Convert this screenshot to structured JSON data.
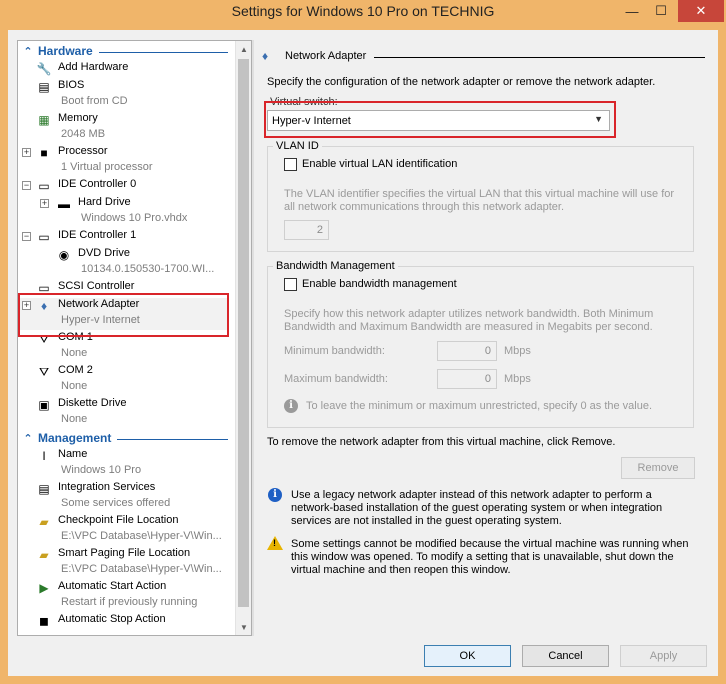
{
  "window": {
    "title": "Settings for Windows 10 Pro on TECHNIG",
    "minimize": "—",
    "maximize": "☐",
    "close": "✕"
  },
  "tree": {
    "hardware_label": "Hardware",
    "management_label": "Management",
    "hardware": [
      {
        "label": "Add Hardware",
        "sub": "",
        "icon": "add-hardware-icon"
      },
      {
        "label": "BIOS",
        "sub": "Boot from CD",
        "icon": "bios-icon"
      },
      {
        "label": "Memory",
        "sub": "2048 MB",
        "icon": "memory-icon"
      },
      {
        "label": "Processor",
        "sub": "1 Virtual processor",
        "icon": "processor-icon"
      },
      {
        "label": "IDE Controller 0",
        "sub": "",
        "icon": "ide-controller-icon"
      },
      {
        "label": "Hard Drive",
        "sub": "Windows 10 Pro.vhdx",
        "icon": "hard-drive-icon"
      },
      {
        "label": "IDE Controller 1",
        "sub": "",
        "icon": "ide-controller-icon"
      },
      {
        "label": "DVD Drive",
        "sub": "10134.0.150530-1700.WI...",
        "icon": "dvd-drive-icon"
      },
      {
        "label": "SCSI Controller",
        "sub": "",
        "icon": "scsi-controller-icon"
      },
      {
        "label": "Network Adapter",
        "sub": "Hyper-v Internet",
        "icon": "network-adapter-icon"
      },
      {
        "label": "COM 1",
        "sub": "None",
        "icon": "com-port-icon"
      },
      {
        "label": "COM 2",
        "sub": "None",
        "icon": "com-port-icon"
      },
      {
        "label": "Diskette Drive",
        "sub": "None",
        "icon": "diskette-icon"
      }
    ],
    "management": [
      {
        "label": "Name",
        "sub": "Windows 10 Pro",
        "icon": "name-icon"
      },
      {
        "label": "Integration Services",
        "sub": "Some services offered",
        "icon": "integration-services-icon"
      },
      {
        "label": "Checkpoint File Location",
        "sub": "E:\\VPC Database\\Hyper-V\\Win...",
        "icon": "folder-icon"
      },
      {
        "label": "Smart Paging File Location",
        "sub": "E:\\VPC Database\\Hyper-V\\Win...",
        "icon": "folder-icon"
      },
      {
        "label": "Automatic Start Action",
        "sub": "Restart if previously running",
        "icon": "auto-start-icon"
      },
      {
        "label": "Automatic Stop Action",
        "sub": "",
        "icon": "auto-stop-icon"
      }
    ]
  },
  "panel": {
    "title": "Network Adapter",
    "description": "Specify the configuration of the network adapter or remove the network adapter.",
    "virtual_switch_label": "Virtual switch:",
    "virtual_switch_value": "Hyper-v Internet",
    "vlan": {
      "title": "VLAN ID",
      "checkbox_label": "Enable virtual LAN identification",
      "help": "The VLAN identifier specifies the virtual LAN that this virtual machine will use for all network communications through this network adapter.",
      "value": "2"
    },
    "bandwidth": {
      "title": "Bandwidth Management",
      "checkbox_label": "Enable bandwidth management",
      "help": "Specify how this network adapter utilizes network bandwidth. Both Minimum Bandwidth and Maximum Bandwidth are measured in Megabits per second.",
      "min_label": "Minimum bandwidth:",
      "min_value": "0",
      "max_label": "Maximum bandwidth:",
      "max_value": "0",
      "unit": "Mbps",
      "note": "To leave the minimum or maximum unrestricted, specify 0 as the value."
    },
    "remove_text": "To remove the network adapter from this virtual machine, click Remove.",
    "remove_button": "Remove",
    "legacy_info": "Use a legacy network adapter instead of this network adapter to perform a network-based installation of the guest operating system or when integration services are not installed in the guest operating system.",
    "warning": "Some settings cannot be modified because the virtual machine was running when this window was opened. To modify a setting that is unavailable, shut down the virtual machine and then reopen this window."
  },
  "buttons": {
    "ok": "OK",
    "cancel": "Cancel",
    "apply": "Apply"
  },
  "colors": {
    "accent": "#1e5fa8",
    "highlight_box": "#d9252a",
    "frame": "#f0b56a"
  }
}
